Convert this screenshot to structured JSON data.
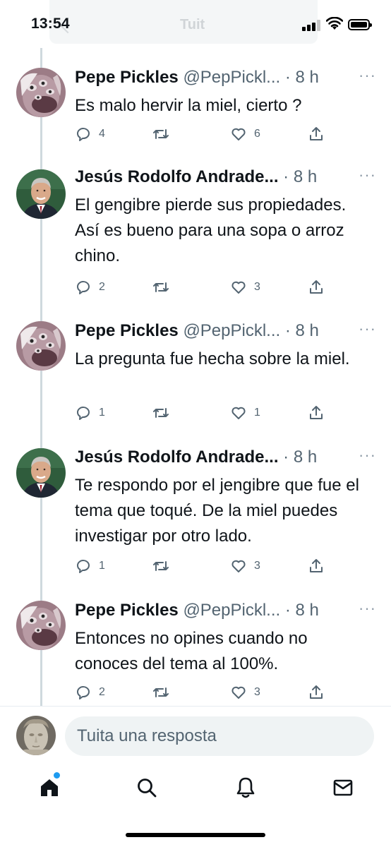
{
  "status_bar": {
    "time": "13:54",
    "ghost_title": "Tuit",
    "icons": [
      "signal-icon",
      "wifi-icon",
      "battery-icon"
    ]
  },
  "tweets": [
    {
      "display_name": "Pepe Pickles",
      "handle": "@PepPickl...",
      "time": "· 8 h",
      "text": "Es malo hervir la miel, cierto ?",
      "replies": "4",
      "retweets": "",
      "likes": "6",
      "avatar": "pepe-avatar"
    },
    {
      "display_name": "Jesús Rodolfo Andrade...",
      "handle": "",
      "time": "· 8 h",
      "text": "El gengibre pierde sus propiedades. Así es bueno para una sopa o arroz chino.",
      "replies": "2",
      "retweets": "",
      "likes": "3",
      "avatar": "jesus-avatar"
    },
    {
      "display_name": "Pepe Pickles",
      "handle": "@PepPickl...",
      "time": "· 8 h",
      "text": "La pregunta fue hecha sobre la miel.",
      "replies": "1",
      "retweets": "",
      "likes": "1",
      "avatar": "pepe-avatar"
    },
    {
      "display_name": "Jesús Rodolfo Andrade...",
      "handle": "",
      "time": "· 8 h",
      "text": "Te respondo por el jengibre que fue el tema que toqué. De la miel puedes investigar por otro lado.",
      "replies": "1",
      "retweets": "",
      "likes": "3",
      "avatar": "jesus-avatar"
    },
    {
      "display_name": "Pepe Pickles",
      "handle": "@PepPickl...",
      "time": "· 8 h",
      "text": "Entonces no opines cuando no conoces del tema al 100%.",
      "replies": "2",
      "retweets": "",
      "likes": "3",
      "avatar": "pepe-avatar"
    }
  ],
  "more_label": "···",
  "reply_bar": {
    "placeholder": "Tuita una resposta"
  },
  "tab_bar": {
    "tabs": [
      "home-icon",
      "search-icon",
      "bell-icon",
      "mail-icon"
    ]
  },
  "colors": {
    "text": "#0f1419",
    "secondary": "#536471",
    "accent": "#1d9bf0",
    "thread_line": "#cfd9de",
    "input_bg": "#eff3f4"
  }
}
